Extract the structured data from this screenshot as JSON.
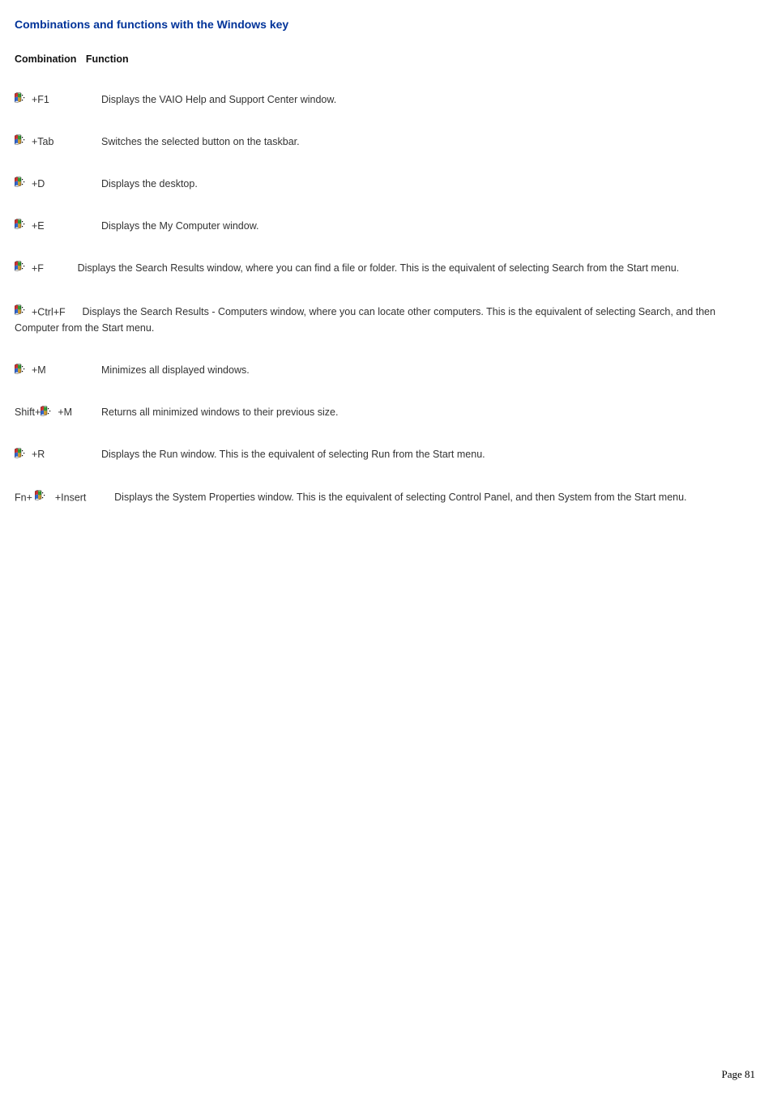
{
  "title": "Combinations and functions with the Windows key",
  "headers": {
    "combination": "Combination",
    "function": "Function"
  },
  "rows": {
    "f1": {
      "combo": "+F1",
      "func": "Displays the VAIO Help and Support Center window."
    },
    "tab": {
      "combo": "+Tab",
      "func": "Switches the selected button on the taskbar."
    },
    "d": {
      "combo": "+D",
      "func": "Displays the desktop."
    },
    "e": {
      "combo": "+E",
      "func": "Displays the My Computer window."
    },
    "f": {
      "combo": "+F",
      "func": "Displays the Search Results window, where you can find a file or folder. This is the equivalent of selecting Search from the Start menu."
    },
    "ctrlf": {
      "combo": "+Ctrl+F",
      "func": "Displays the Search Results - Computers window, where you can locate other computers. This is the equivalent of selecting Search, and then Computer from the Start menu."
    },
    "m": {
      "combo": "+M",
      "func": "Minimizes all displayed windows."
    },
    "shiftm": {
      "prefix": "Shift+",
      "combo": " +M",
      "func": "Returns all minimized windows to their previous size."
    },
    "r": {
      "combo": "+R",
      "func": "Displays the Run window. This is the equivalent of selecting Run from the Start menu."
    },
    "fnins": {
      "prefix": "Fn+",
      "combo": " +Insert",
      "func": "Displays the System Properties window. This is the equivalent of selecting Control Panel, and then System from the Start menu."
    }
  },
  "page_number": "Page 81"
}
